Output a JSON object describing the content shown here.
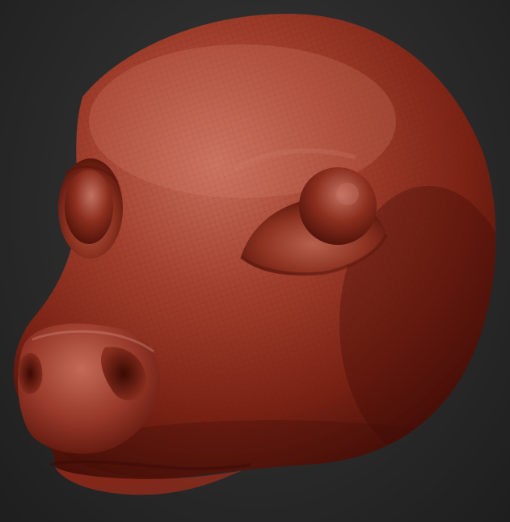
{
  "scene": {
    "subject_icon": "sculpted-creature-head-icon",
    "colors": {
      "background_center": "#3a3a3a",
      "background_edge": "#1e1e1e",
      "clay_base": "#8a2a1c",
      "clay_light": "#c56a58",
      "clay_shadow": "#3e0c06",
      "wire": "#5a160c"
    }
  }
}
